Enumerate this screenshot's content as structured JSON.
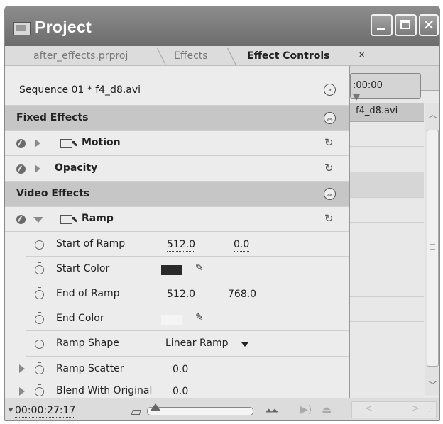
{
  "window": {
    "title": "Project",
    "buttons": {
      "minimize": "_",
      "maximize": "□",
      "close": "✕"
    }
  },
  "tabs": [
    {
      "label": "after_effects.prproj"
    },
    {
      "label": "Effects"
    },
    {
      "label": "Effect Controls",
      "close": "✕",
      "active": true
    }
  ],
  "header": {
    "sequence_label": "Sequence 01 * f4_d8.avi"
  },
  "sections": {
    "fixed_effects": "Fixed Effects",
    "video_effects": "Video Effects"
  },
  "effects": {
    "motion": "Motion",
    "opacity": "Opacity",
    "ramp": "Ramp"
  },
  "ramp_properties": [
    {
      "label": "Start of Ramp",
      "value1": "512.0",
      "value2": "0.0"
    },
    {
      "label": "Start Color",
      "color": "#2a2a2a"
    },
    {
      "label": "End of Ramp",
      "value1": "512.0",
      "value2": "768.0"
    },
    {
      "label": "End Color",
      "color": "#f4f4f4"
    },
    {
      "label": "Ramp Shape",
      "value1": "Linear Ramp"
    },
    {
      "label": "Ramp Scatter",
      "value1": "0.0"
    },
    {
      "label": "Blend With Original",
      "value1": "0.0"
    }
  ],
  "timeline": {
    "time": ":00:00",
    "clip_label": "f4_d8.avi"
  },
  "bottom": {
    "current_time": "00:00:27:17"
  },
  "icons": [
    "app-icon",
    "panel-menu-icon",
    "collapse-icon",
    "toggle-effect-icon",
    "expand-triangle-icon",
    "motion-icon",
    "reset-icon",
    "stopwatch-icon",
    "eyedropper-icon",
    "dropdown-arrow-icon",
    "zoom-out-icon",
    "zoom-in-icon",
    "play-audio-icon",
    "export-icon",
    "scroll-left-icon",
    "scroll-right-icon"
  ]
}
